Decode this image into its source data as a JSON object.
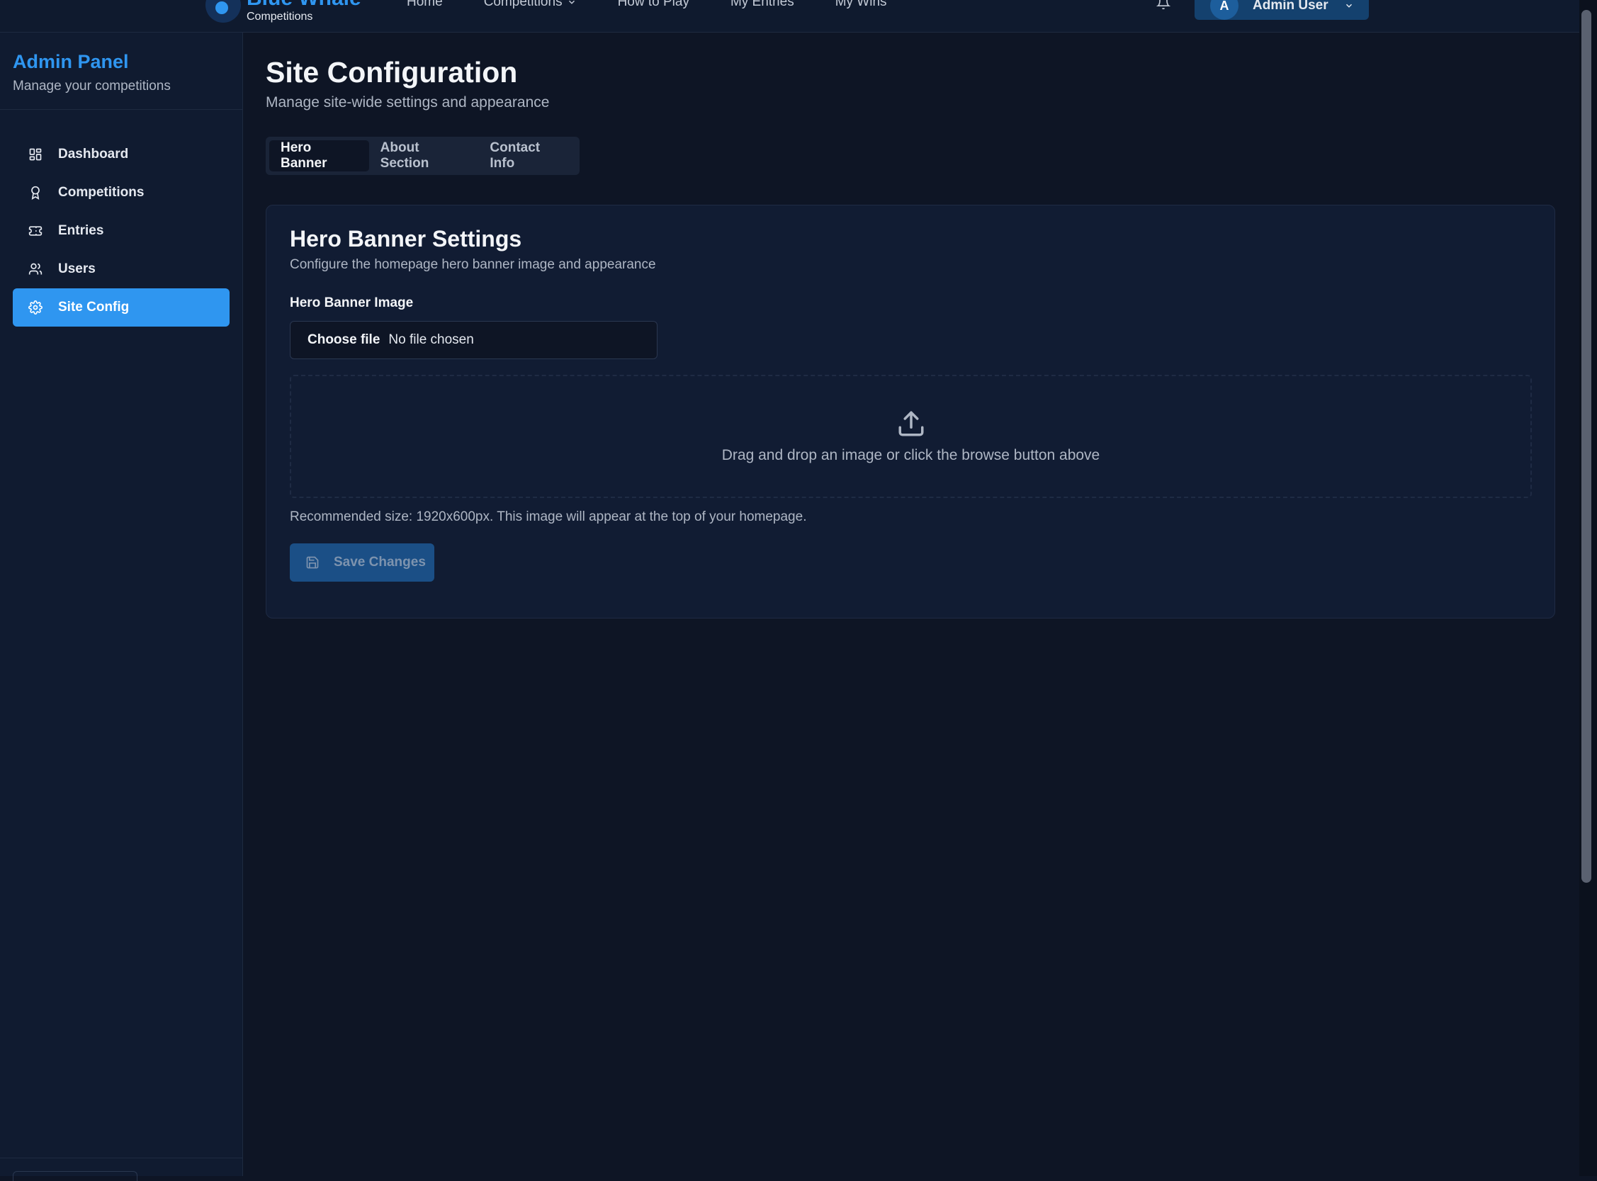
{
  "topnav": {
    "brand_title": "Blue Whale",
    "brand_sub": "Competitions",
    "links": [
      "Home",
      "Competitions",
      "How to Play",
      "My Entries",
      "My Wins"
    ],
    "user_initial": "A",
    "user_name": "Admin User"
  },
  "sidebar": {
    "title": "Admin Panel",
    "subtitle": "Manage your competitions",
    "items": [
      {
        "label": "Dashboard",
        "icon": "dashboard-icon"
      },
      {
        "label": "Competitions",
        "icon": "award-icon"
      },
      {
        "label": "Entries",
        "icon": "ticket-icon"
      },
      {
        "label": "Users",
        "icon": "users-icon"
      },
      {
        "label": "Site Config",
        "icon": "gear-icon",
        "active": true
      }
    ]
  },
  "page": {
    "title": "Site Configuration",
    "subtitle": "Manage site-wide settings and appearance",
    "tabs": [
      "Hero Banner",
      "About Section",
      "Contact Info"
    ],
    "active_tab": "Hero Banner"
  },
  "card": {
    "title": "Hero Banner Settings",
    "subtitle": "Configure the homepage hero banner image and appearance",
    "field_label": "Hero Banner Image",
    "file_button": "Choose file",
    "file_status": "No file chosen",
    "dropzone_text": "Drag and drop an image or click the browse button above",
    "hint": "Recommended size: 1920x600px. This image will appear at the top of your homepage.",
    "save_label": "Save Changes"
  },
  "colors": {
    "background": "#0e1525",
    "accent": "#2f96f0",
    "panel": "#111c33"
  }
}
